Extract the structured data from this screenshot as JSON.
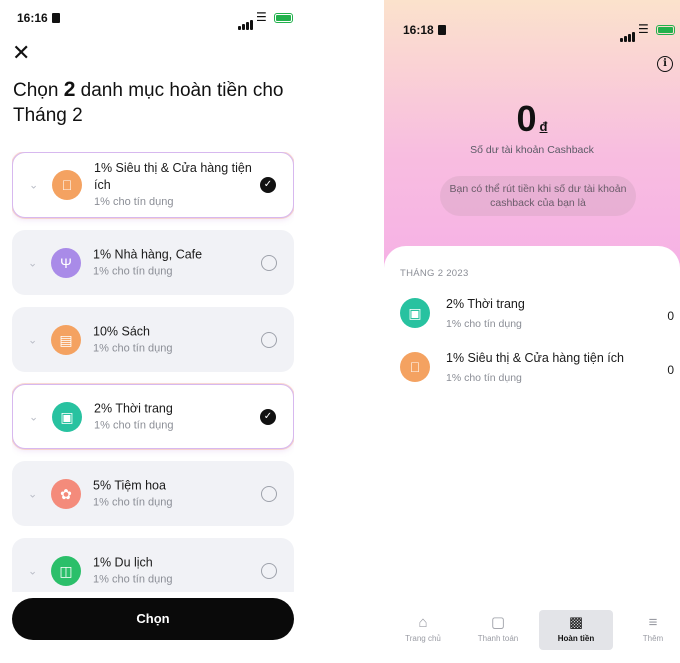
{
  "left": {
    "time": "16:16",
    "heading_prefix": "Chọn",
    "heading_count": "2",
    "heading_rest": "danh mục hoàn tiền cho Tháng 2",
    "categories": [
      {
        "name": "1% Siêu thị & Cửa hàng tiện ích",
        "sub": "1% cho tín dụng",
        "icon": "apple-icon",
        "color": "#f4a261",
        "selected": true
      },
      {
        "name": "1% Nhà hàng, Cafe",
        "sub": "1% cho tín dụng",
        "icon": "fork-knife-icon",
        "color": "#a98be8",
        "selected": false
      },
      {
        "name": "10% Sách",
        "sub": "1% cho tín dụng",
        "icon": "book-icon",
        "color": "#f4a261",
        "selected": false
      },
      {
        "name": "2% Thời trang",
        "sub": "1% cho tín dụng",
        "icon": "shopping-bag-icon",
        "color": "#28c2a0",
        "selected": true
      },
      {
        "name": "5% Tiệm hoa",
        "sub": "1% cho tín dụng",
        "icon": "flower-icon",
        "color": "#f48b7b",
        "selected": false
      },
      {
        "name": "1% Du lịch",
        "sub": "1% cho tín dụng",
        "icon": "luggage-icon",
        "color": "#2bbf6a",
        "selected": false
      }
    ],
    "button_label": "Chọn"
  },
  "right": {
    "time": "16:18",
    "balance_value": "0",
    "balance_currency": "đ",
    "balance_label": "Số dư tài khoản Cashback",
    "note": "Bạn có thể rút tiền khi số dư tài khoản cashback của bạn là",
    "month_label": "THÁNG 2 2023",
    "rows": [
      {
        "name": "2% Thời trang",
        "sub": "1% cho tín dụng",
        "amount": "0",
        "icon": "shopping-bag-icon",
        "color": "#28c2a0"
      },
      {
        "name": "1% Siêu thị & Cửa hàng tiện ích",
        "sub": "1% cho tín dụng",
        "amount": "0",
        "icon": "apple-icon",
        "color": "#f4a261"
      }
    ],
    "tabs": [
      {
        "label": "Trang chủ",
        "icon": "home-icon",
        "active": false
      },
      {
        "label": "Thanh toán",
        "icon": "wallet-icon",
        "active": false
      },
      {
        "label": "Hoàn tiền",
        "icon": "gift-icon",
        "active": true
      },
      {
        "label": "Thêm",
        "icon": "menu-icon",
        "active": false
      }
    ]
  }
}
